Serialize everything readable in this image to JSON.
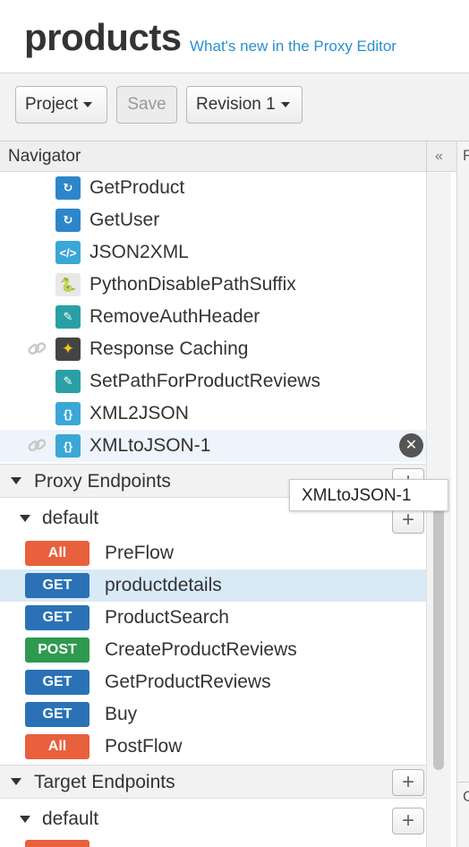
{
  "header": {
    "title": "products",
    "whats_new": "What's new in the Proxy Editor"
  },
  "toolbar": {
    "project_label": "Project",
    "save_label": "Save",
    "revision_label": "Revision 1"
  },
  "navigator": {
    "title": "Navigator",
    "collapse_label": "«",
    "right_panel_f": "F",
    "right_panel_c": "C"
  },
  "policies": [
    {
      "label": "GetProduct",
      "icon": "service-callout-icon",
      "color": "#2d86c9",
      "glyph": "↻"
    },
    {
      "label": "GetUser",
      "icon": "service-callout-icon",
      "color": "#2d86c9",
      "glyph": "↻"
    },
    {
      "label": "JSON2XML",
      "icon": "json-to-xml-icon",
      "color": "#3ba7d6",
      "glyph": "</>"
    },
    {
      "label": "PythonDisablePathSuffix",
      "icon": "python-icon",
      "color": "#e8e8e8",
      "glyph": "🐍"
    },
    {
      "label": "RemoveAuthHeader",
      "icon": "assign-message-icon",
      "color": "#2aa0a6",
      "glyph": "✎"
    },
    {
      "label": "Response Caching",
      "icon": "response-cache-icon",
      "color": "#444444",
      "glyph": "✦"
    },
    {
      "label": "SetPathForProductReviews",
      "icon": "assign-message-icon",
      "color": "#2aa0a6",
      "glyph": "✎"
    },
    {
      "label": "XML2JSON",
      "icon": "xml-to-json-icon",
      "color": "#3ba7d6",
      "glyph": "{}"
    },
    {
      "label": "XMLtoJSON-1",
      "icon": "xml-to-json-icon",
      "color": "#3ba7d6",
      "glyph": "{}"
    }
  ],
  "proxy_endpoints": {
    "label": "Proxy Endpoints",
    "default_label": "default",
    "flows": [
      {
        "verb": "All",
        "name": "PreFlow",
        "color": "#e8603c"
      },
      {
        "verb": "GET",
        "name": "productdetails",
        "color": "#2a72b5"
      },
      {
        "verb": "GET",
        "name": "ProductSearch",
        "color": "#2a72b5"
      },
      {
        "verb": "POST",
        "name": "CreateProductReviews",
        "color": "#2e9a4f"
      },
      {
        "verb": "GET",
        "name": "GetProductReviews",
        "color": "#2a72b5"
      },
      {
        "verb": "GET",
        "name": "Buy",
        "color": "#2a72b5"
      },
      {
        "verb": "All",
        "name": "PostFlow",
        "color": "#e8603c"
      }
    ]
  },
  "target_endpoints": {
    "label": "Target Endpoints",
    "default_label": "default"
  },
  "tooltip": {
    "text": "XMLtoJSON-1"
  },
  "plus_label": "+",
  "remove_label": "✕"
}
